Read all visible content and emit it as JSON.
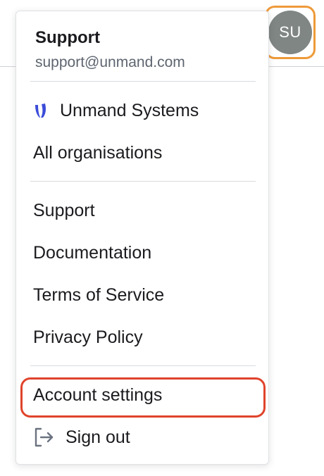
{
  "avatar": {
    "initials": "SU"
  },
  "user": {
    "name": "Support",
    "email": "support@unmand.com"
  },
  "organisations": {
    "current": {
      "label": "Unmand Systems",
      "icon": "unmand-logo-icon",
      "icon_color": "#3b4cd9"
    },
    "all_label": "All organisations"
  },
  "links": [
    {
      "label": "Support"
    },
    {
      "label": "Documentation"
    },
    {
      "label": "Terms of Service"
    },
    {
      "label": "Privacy Policy"
    }
  ],
  "account": {
    "settings_label": "Account settings",
    "sign_out_label": "Sign out",
    "sign_out_icon": "sign-out-icon"
  },
  "colors": {
    "avatar_focus_ring": "#ee9a3a",
    "highlight_ring": "#e0442c",
    "avatar_bg": "#7f8684"
  }
}
